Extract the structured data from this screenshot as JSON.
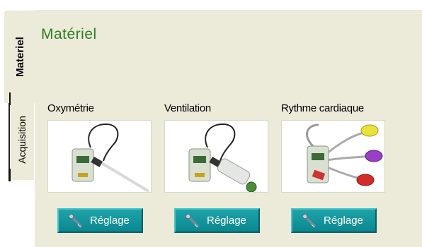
{
  "tabs": [
    {
      "label": "Materiel",
      "active": true
    },
    {
      "label": "Acquisition",
      "active": false
    }
  ],
  "panel": {
    "title": "Matériel",
    "title_color": "#2e7d22",
    "background_color": "#ecead9",
    "devices": [
      {
        "label": "Oxymétrie",
        "image_icon": "oximetry-sensor-icon",
        "button_label": "Réglage",
        "button_icon": "wrench-icon"
      },
      {
        "label": "Ventilation",
        "image_icon": "ventilation-sensor-icon",
        "button_label": "Réglage",
        "button_icon": "wrench-icon"
      },
      {
        "label": "Rythme cardiaque",
        "image_icon": "ecg-electrodes-icon",
        "button_label": "Réglage",
        "button_icon": "wrench-icon"
      }
    ],
    "button_color": "#13959c"
  }
}
